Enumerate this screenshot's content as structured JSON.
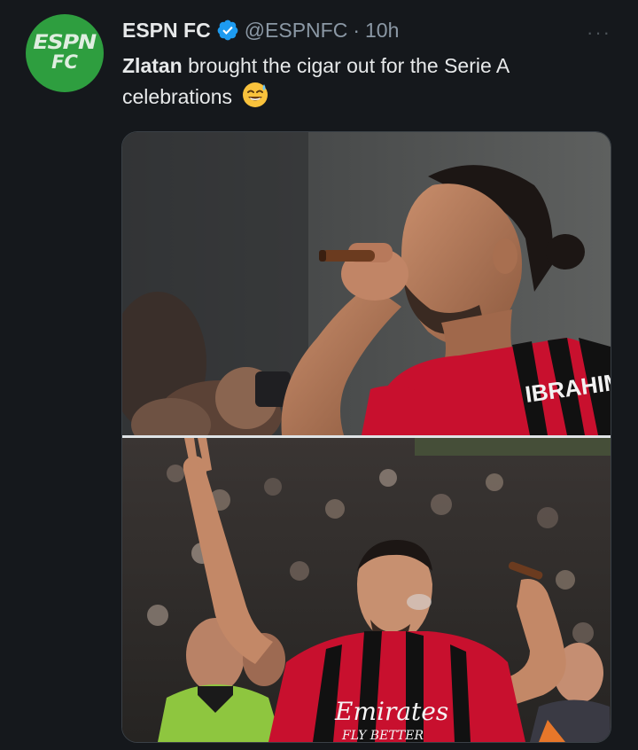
{
  "tweet": {
    "avatar_logo_top": "ESPN",
    "avatar_logo_bottom": "FC",
    "display_name": "ESPN FC",
    "handle": "@ESPNFC",
    "separator": "·",
    "time": "10h",
    "more_label": "···",
    "text_bold": "Zlatan",
    "text_rest": " brought the cigar out for the Serie A celebrations",
    "emoji": "smiling-face-with-sweat-icon"
  },
  "media": {
    "photo_count": 2,
    "jersey_text_top": "IBRAHIMOVIC",
    "jersey_sponsor": "Emirates",
    "jersey_sponsor_sub": "FLY BETTER"
  },
  "colors": {
    "background": "#15181c",
    "avatar_green": "#2e9e3f",
    "verified_blue": "#1d9bf0",
    "muted_text": "#8b98a5",
    "milan_red": "#c8102e"
  }
}
